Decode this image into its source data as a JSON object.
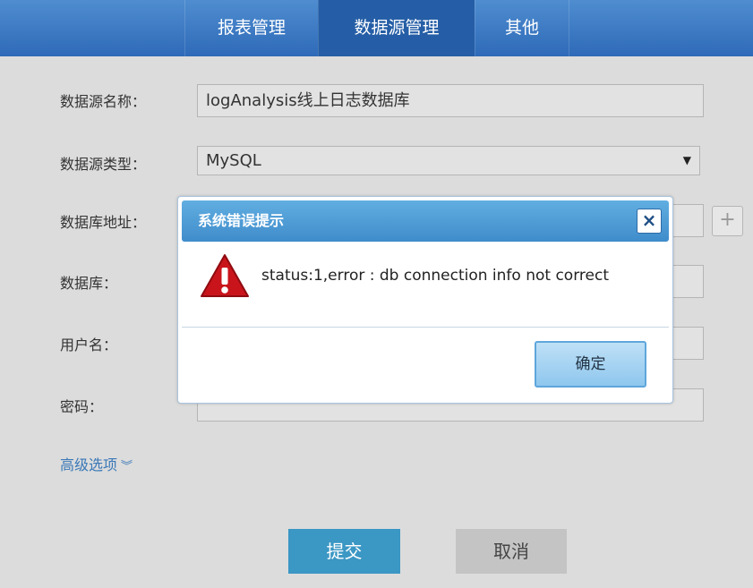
{
  "nav": {
    "tabs": [
      {
        "label": "报表管理"
      },
      {
        "label": "数据源管理"
      },
      {
        "label": "其他"
      }
    ],
    "active_tab": "数据源管理"
  },
  "form": {
    "name_label": "数据源名称：",
    "name_value": "logAnalysis线上日志数据库",
    "type_label": "数据源类型：",
    "type_value": "MySQL",
    "address_label": "数据库地址：",
    "database_label": "数据库：",
    "username_label": "用户名：",
    "password_label": "密码：",
    "advanced_label": "高级选项",
    "plus": "+"
  },
  "actions": {
    "submit": "提交",
    "cancel": "取消"
  },
  "dialog": {
    "title": "系统错误提示",
    "close": "×",
    "message": "status:1,error : db connection info not correct",
    "ok": "确定"
  },
  "colors": {
    "nav": "#2e6ab8",
    "submit": "#3b97c4",
    "warning": "#c9141b"
  }
}
